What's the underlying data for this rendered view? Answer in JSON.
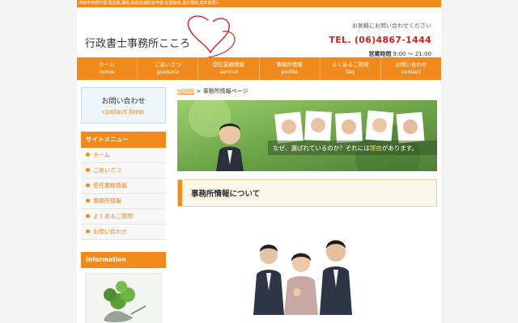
{
  "topbar": {
    "text": "浜田市申請代理,建設業,風俗,助成金補助金申請,在留資格,遺言相続,成年後見人"
  },
  "header": {
    "logo": "行政書士事務所こころ",
    "contact_note": "お気軽にお問い合わせください",
    "tel": "TEL. (06)4867-1444",
    "hours_label": "営業時間",
    "hours": "9:00 〜 21:00"
  },
  "nav": [
    {
      "jp": "ホーム",
      "en": "home"
    },
    {
      "jp": "ごあいさつ",
      "en": "goaisatu"
    },
    {
      "jp": "受任業務情報",
      "en": "service"
    },
    {
      "jp": "事務所情報",
      "en": "profile"
    },
    {
      "jp": "よくあるご質問",
      "en": "faq"
    },
    {
      "jp": "お問い合わせ",
      "en": "contact"
    }
  ],
  "sidebar": {
    "contact_jp": "お問い合わせ",
    "contact_en": "contact form",
    "menu_title": "サイトメニュー",
    "menu": [
      "ホーム",
      "ごあいさつ",
      "受任業務情報",
      "事務所情報",
      "よくあるご質問",
      "お問い合わせ"
    ],
    "info_title": "Information"
  },
  "main": {
    "crumb_home": "HOME",
    "crumb_sep": " > ",
    "crumb_current": "事務所情報ページ",
    "banner_caption_a": "なぜ、選ばれているのか？それには",
    "banner_caption_hl": "理由",
    "banner_caption_b": "があります。",
    "section_title": "事務所情報について"
  },
  "colors": {
    "accent": "#f08a1c",
    "tel": "#d0211f",
    "link": "#e2821d"
  }
}
